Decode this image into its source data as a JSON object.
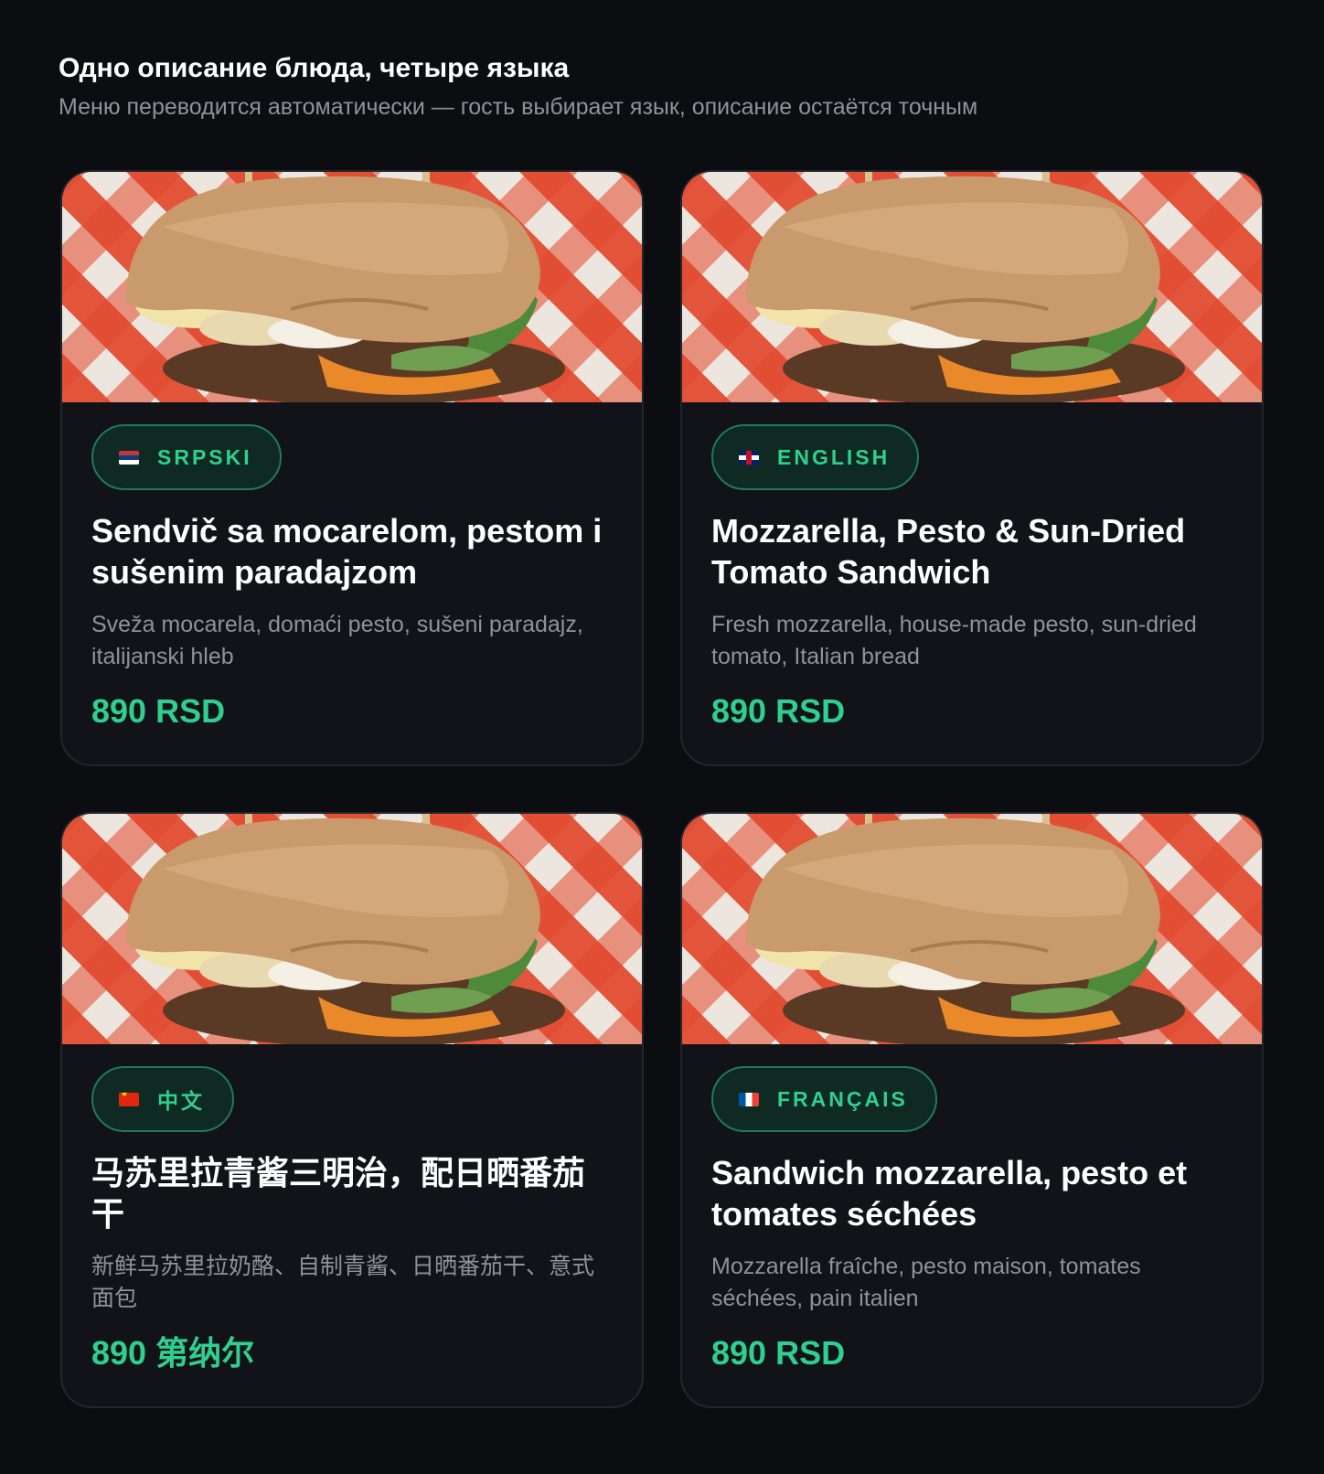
{
  "header": {
    "title": "Одно описание блюда, четыре языка",
    "subtitle": "Меню переводится автоматически — гость выбирает язык, описание остаётся точным"
  },
  "colors": {
    "background": "#0b0d11",
    "card": "#111318",
    "accent": "#2fd08f",
    "muted_text": "#8d939c"
  },
  "cards": [
    {
      "language": "SRPSKI",
      "flag_icon": "serbia-flag-icon",
      "title": "Sendvič sa mocarelom, pestom i sušenim paradajzom",
      "description": "Sveža mocarela, domaći pesto, sušeni paradajz, italijanski hleb",
      "price": "890 RSD"
    },
    {
      "language": "ENGLISH",
      "flag_icon": "uk-flag-icon",
      "title": "Mozzarella, Pesto & Sun-Dried Tomato Sandwich",
      "description": "Fresh mozzarella, house-made pesto, sun-dried tomato, Italian bread",
      "price": "890 RSD"
    },
    {
      "language": "中文",
      "flag_icon": "china-flag-icon",
      "title": "马苏里拉青酱三明治，配日晒番茄干",
      "description": "新鲜马苏里拉奶酪、自制青酱、日晒番茄干、意式面包",
      "price": "890 第纳尔"
    },
    {
      "language": "FRANÇAIS",
      "flag_icon": "france-flag-icon",
      "title": "Sandwich mozzarella, pesto et tomates séchées",
      "description": "Mozzarella fraîche, pesto maison, tomates séchées, pain italien",
      "price": "890 RSD"
    }
  ]
}
